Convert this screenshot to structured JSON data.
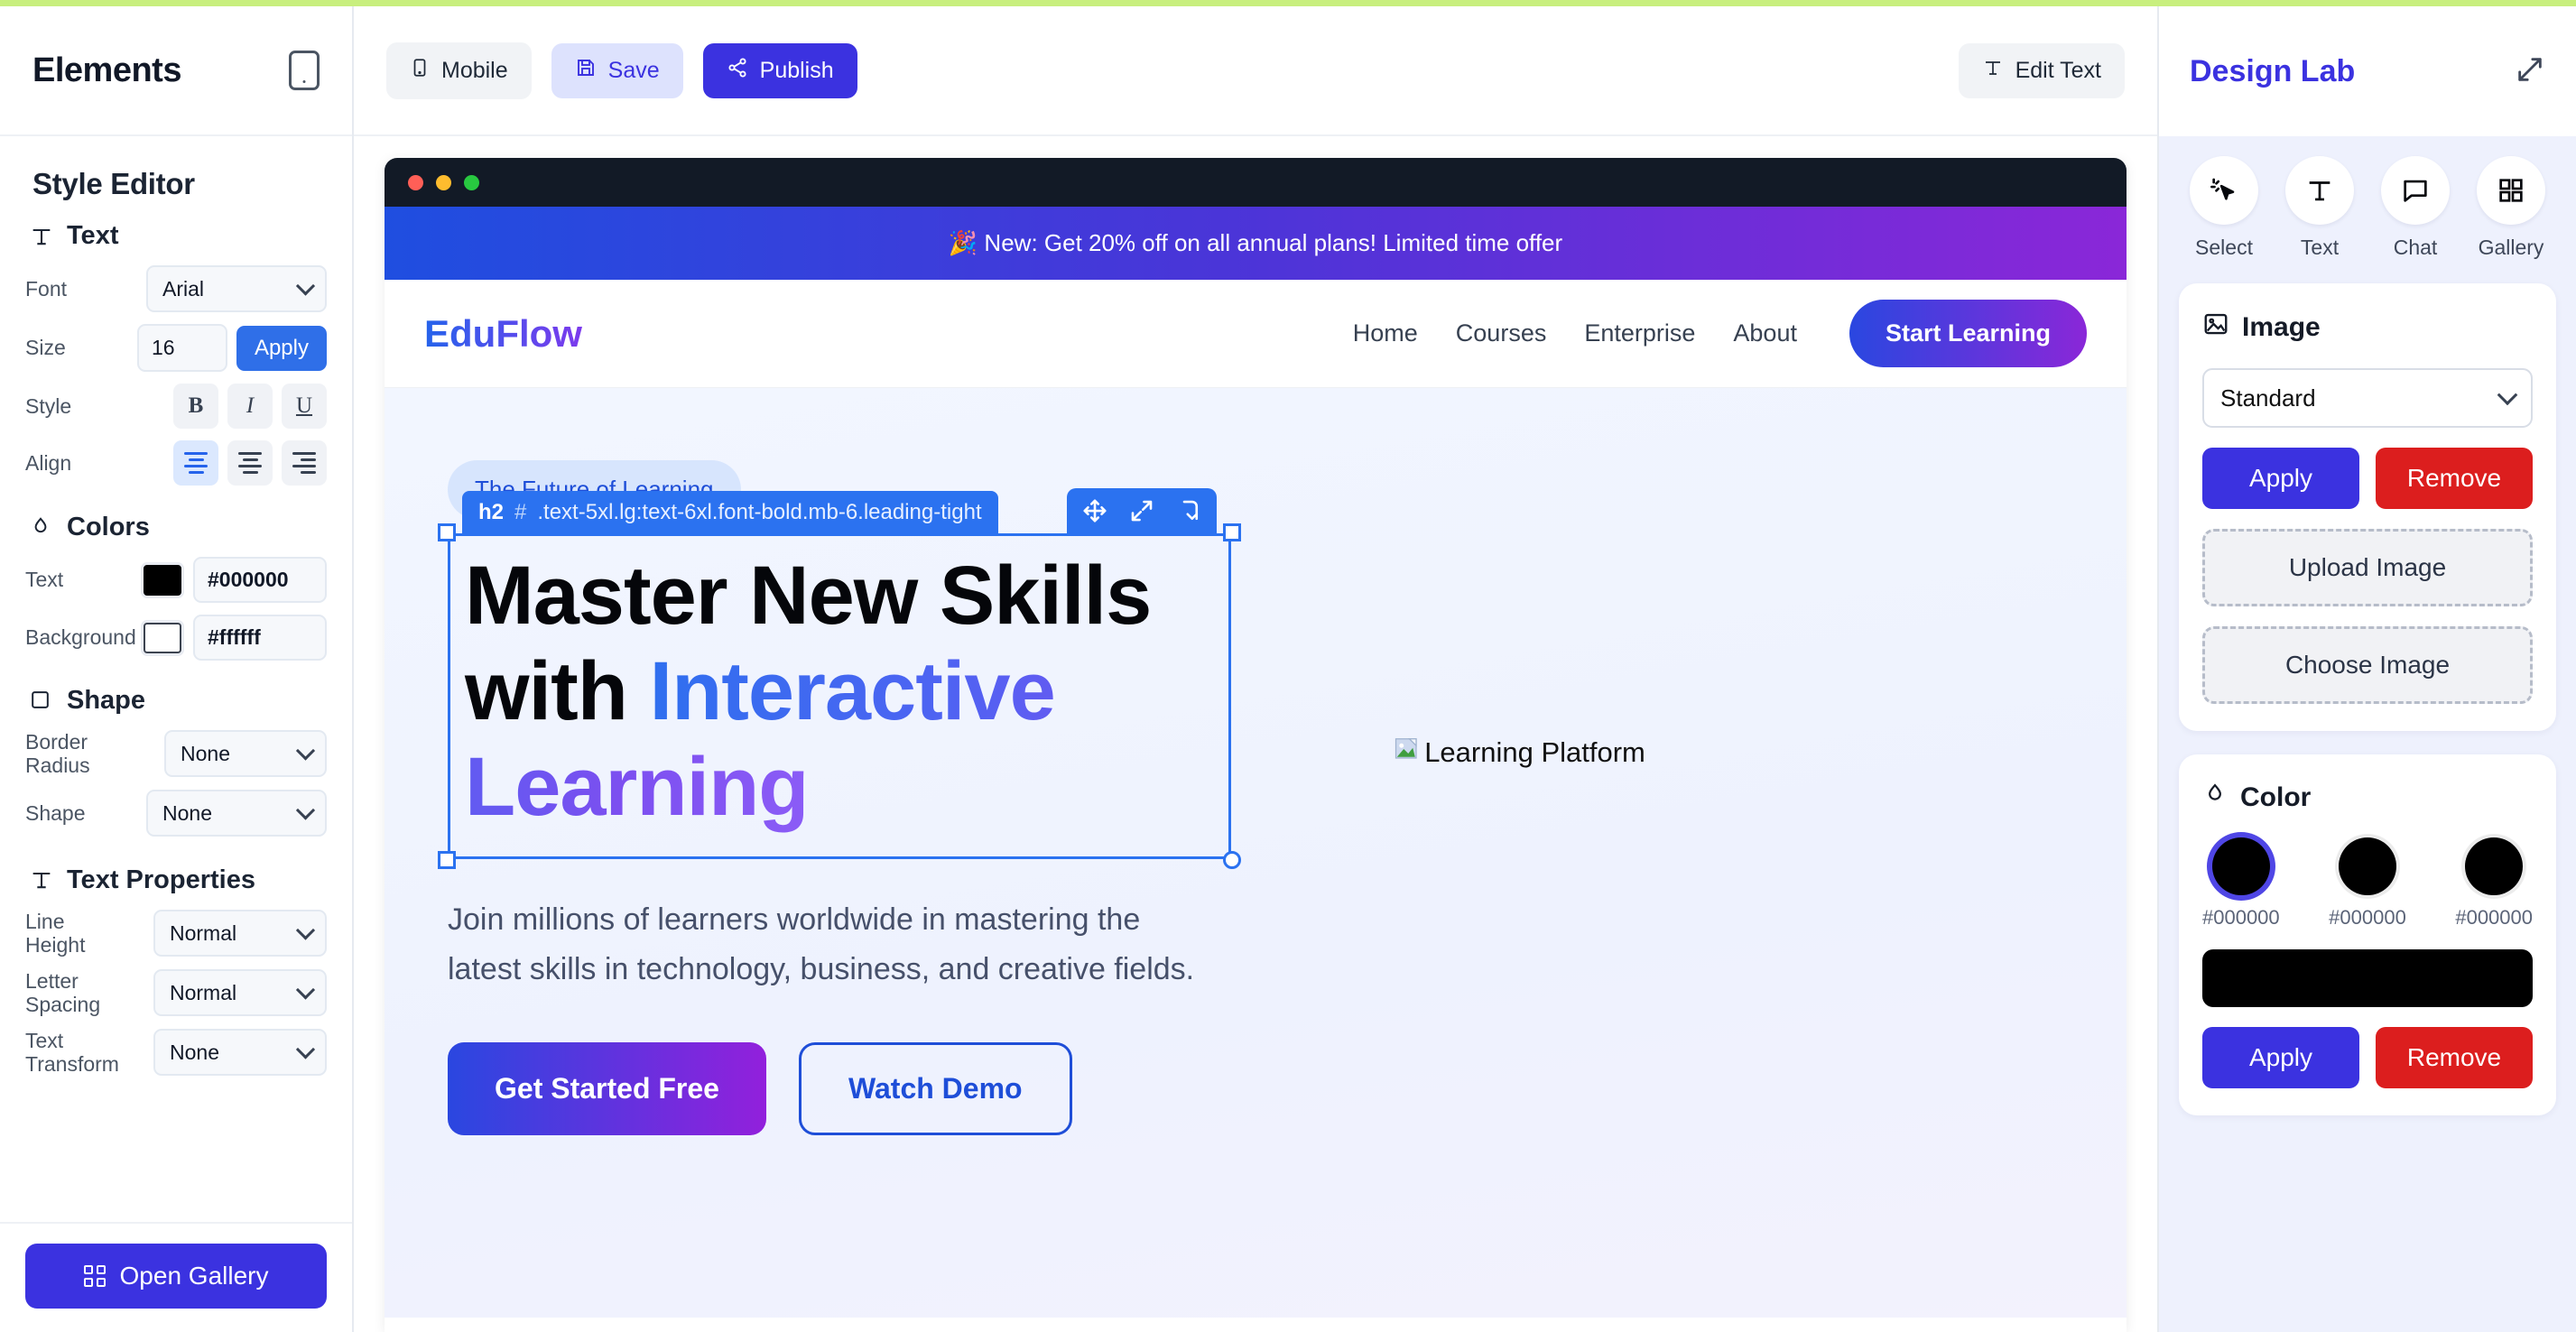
{
  "accent_color": "#c8ef7e",
  "left_sidebar": {
    "title": "Elements",
    "device_icon": "phone-icon",
    "style_editor_title": "Style Editor",
    "text_section": {
      "icon": "text-icon",
      "label": "Text",
      "font_label": "Font",
      "font_value": "Arial",
      "font_options": [
        "Arial"
      ],
      "size_label": "Size",
      "size_value": "16",
      "apply_label": "Apply",
      "style_label": "Style",
      "style_buttons": [
        "B",
        "I",
        "U"
      ],
      "align_label": "Align",
      "align_buttons": [
        "align-left",
        "align-center",
        "align-right"
      ]
    },
    "colors_section": {
      "icon": "droplet-icon",
      "label": "Colors",
      "text_label": "Text",
      "text_color": "#000000",
      "background_label": "Background",
      "background_color": "#ffffff"
    },
    "shape_section": {
      "icon": "square-icon",
      "label": "Shape",
      "border_radius_label": "Border Radius",
      "border_radius_value": "None",
      "shape_label": "Shape",
      "shape_value": "None"
    },
    "text_properties_section": {
      "icon": "text-icon",
      "label": "Text Properties",
      "line_height_label": "Line Height",
      "line_height_value": "Normal",
      "letter_spacing_label": "Letter Spacing",
      "letter_spacing_value": "Normal",
      "text_transform_label": "Text Transform",
      "text_transform_value": "None"
    },
    "footer": {
      "open_gallery_label": "Open Gallery",
      "open_gallery_icon": "grid-icon"
    }
  },
  "toolbar": {
    "mobile_label": "Mobile",
    "mobile_icon": "phone-icon",
    "save_label": "Save",
    "save_icon": "save-disk-icon",
    "publish_label": "Publish",
    "publish_icon": "share-icon",
    "edit_text_label": "Edit Text",
    "edit_text_icon": "text-icon"
  },
  "canvas": {
    "window_dots": [
      "#ff5f57",
      "#febc2e",
      "#28c840"
    ],
    "promo_banner": "🎉 New: Get 20% off on all annual plans! Limited time offer",
    "site_nav": {
      "logo": "EduFlow",
      "links": [
        "Home",
        "Courses",
        "Enterprise",
        "About"
      ],
      "cta_label": "Start Learning"
    },
    "hero": {
      "pill": "The Future of Learning",
      "selection": {
        "tag_element": "h2",
        "tag_hash": "#",
        "tag_classes": ".text-5xl.lg:text-6xl.font-bold.mb-6.leading-tight",
        "tools": [
          "move-icon",
          "resize-icon",
          "rotate-icon"
        ]
      },
      "headline_plain": "Master New Skills with ",
      "headline_gradient": "Interactive Learning",
      "subtext": "Join millions of learners worldwide in mastering the latest skills in technology, business, and creative fields.",
      "cta_primary": "Get Started Free",
      "cta_secondary": "Watch Demo",
      "broken_image_alt": "Learning Platform"
    }
  },
  "right_panel": {
    "title": "Design Lab",
    "expand_icon": "expand-arrows-icon",
    "tabs": [
      {
        "label": "Select",
        "icon": "cursor-click-icon"
      },
      {
        "label": "Text",
        "icon": "text-icon"
      },
      {
        "label": "Chat",
        "icon": "chat-bubble-icon"
      },
      {
        "label": "Gallery",
        "icon": "grid-icon"
      }
    ],
    "image_card": {
      "icon": "image-icon",
      "title": "Image",
      "select_value": "Standard",
      "select_options": [
        "Standard"
      ],
      "apply_label": "Apply",
      "remove_label": "Remove",
      "upload_label": "Upload Image",
      "choose_label": "Choose Image"
    },
    "color_card": {
      "icon": "droplet-icon",
      "title": "Color",
      "swatches": [
        {
          "hex": "#000000",
          "selected": true
        },
        {
          "hex": "#000000",
          "selected": false
        },
        {
          "hex": "#000000",
          "selected": false
        }
      ],
      "preview_color": "#000000",
      "apply_label": "Apply",
      "remove_label": "Remove"
    }
  }
}
